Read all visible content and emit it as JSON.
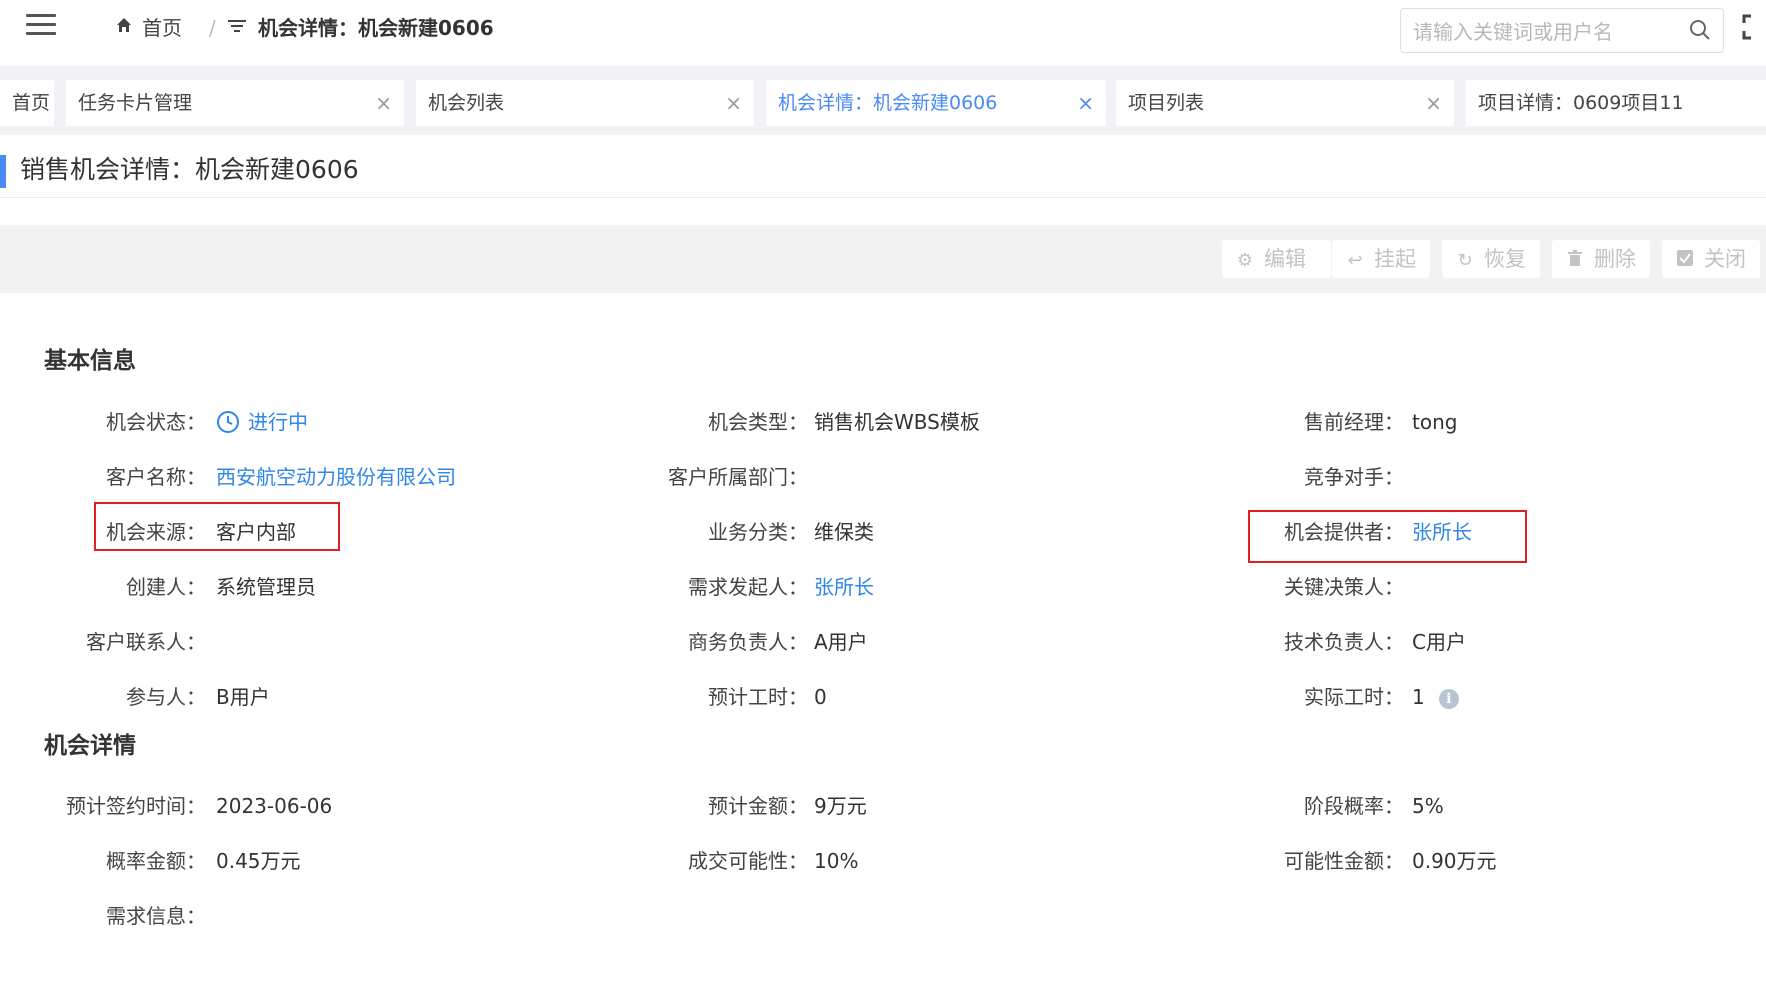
{
  "header": {
    "home_label": "首页",
    "separator": "/",
    "current_label": "机会详情：机会新建0606",
    "search_placeholder": "请输入关键词或用户名"
  },
  "tabs": [
    {
      "label": "首页",
      "closable": false,
      "active": false
    },
    {
      "label": "任务卡片管理",
      "closable": true,
      "active": false
    },
    {
      "label": "机会列表",
      "closable": true,
      "active": false
    },
    {
      "label": "机会详情：机会新建0606",
      "closable": true,
      "active": true
    },
    {
      "label": "项目列表",
      "closable": true,
      "active": false
    },
    {
      "label": "项目详情：0609项目11",
      "closable": false,
      "active": false
    }
  ],
  "close_glyph": "×",
  "page_title": "销售机会详情：机会新建0606",
  "toolbar": {
    "edit": "编辑",
    "suspend": "挂起",
    "restore": "恢复",
    "delete": "删除",
    "close": "关闭"
  },
  "basic": {
    "title": "基本信息",
    "fields": {
      "status_label": "机会状态：",
      "status_value": "进行中",
      "type_label": "机会类型：",
      "type_value": "销售机会WBS模板",
      "presales_label": "售前经理：",
      "presales_value": "tong",
      "customer_label": "客户名称：",
      "customer_value": "西安航空动力股份有限公司",
      "dept_label": "客户所属部门：",
      "dept_value": "",
      "competitor_label": "竞争对手：",
      "competitor_value": "",
      "source_label": "机会来源：",
      "source_value": "客户内部",
      "category_label": "业务分类：",
      "category_value": "维保类",
      "provider_label": "机会提供者：",
      "provider_value": "张所长",
      "creator_label": "创建人：",
      "creator_value": "系统管理员",
      "initiator_label": "需求发起人：",
      "initiator_value": "张所长",
      "decision_label": "关键决策人：",
      "decision_value": "",
      "contact_label": "客户联系人：",
      "contact_value": "",
      "business_label": "商务负责人：",
      "business_value": "A用户",
      "tech_label": "技术负责人：",
      "tech_value": "C用户",
      "participant_label": "参与人：",
      "participant_value": "B用户",
      "est_hours_label": "预计工时：",
      "est_hours_value": "0",
      "act_hours_label": "实际工时：",
      "act_hours_value": "1"
    }
  },
  "details": {
    "title": "机会详情",
    "fields": {
      "sign_date_label": "预计签约时间：",
      "sign_date_value": "2023-06-06",
      "est_amount_label": "预计金额：",
      "est_amount_value": "9万元",
      "stage_prob_label": "阶段概率：",
      "stage_prob_value": "5%",
      "prob_amount_label": "概率金额：",
      "prob_amount_value": "0.45万元",
      "deal_prob_label": "成交可能性：",
      "deal_prob_value": "10%",
      "possible_amount_label": "可能性金额：",
      "possible_amount_value": "0.90万元",
      "demand_label": "需求信息：",
      "demand_value": ""
    }
  },
  "info_glyph": "i",
  "colors": {
    "accent": "#4a8af4",
    "link": "#2f86e8",
    "highlight_box": "#e02020",
    "disabled_text": "#c3c3c3"
  }
}
